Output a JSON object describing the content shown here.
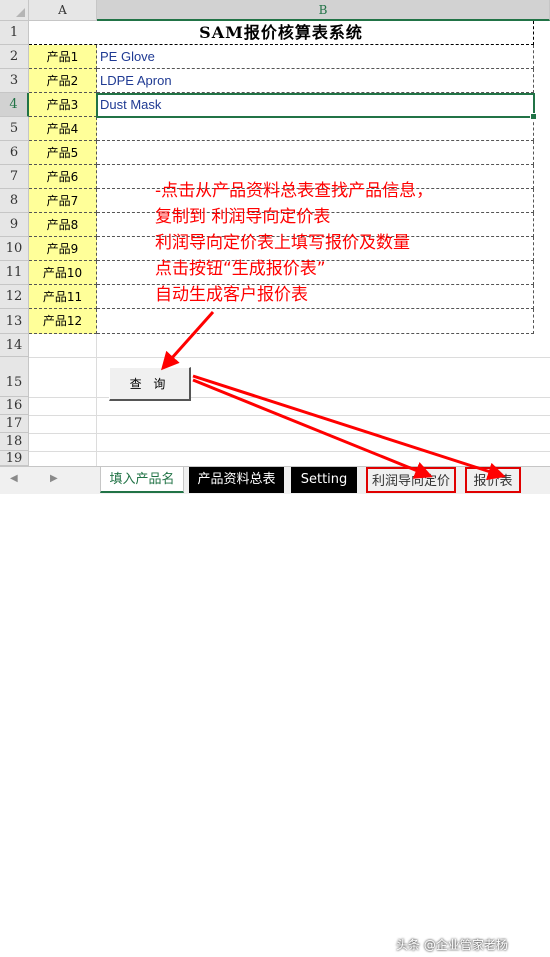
{
  "spreadsheet": {
    "columns": [
      "A",
      "B"
    ],
    "rows": [
      "1",
      "2",
      "3",
      "4",
      "5",
      "6",
      "7",
      "8",
      "9",
      "10",
      "11",
      "12",
      "13",
      "14",
      "15",
      "16",
      "17",
      "18",
      "19"
    ],
    "active_row": "4",
    "active_column": "B",
    "title": "SAM报价核算表系统",
    "products": [
      {
        "label": "产品1",
        "name": "PE Glove"
      },
      {
        "label": "产品2",
        "name": "LDPE Apron"
      },
      {
        "label": "产品3",
        "name": "Dust Mask"
      },
      {
        "label": "产品4",
        "name": ""
      },
      {
        "label": "产品5",
        "name": ""
      },
      {
        "label": "产品6",
        "name": ""
      },
      {
        "label": "产品7",
        "name": ""
      },
      {
        "label": "产品8",
        "name": ""
      },
      {
        "label": "产品9",
        "name": ""
      },
      {
        "label": "产品10",
        "name": ""
      },
      {
        "label": "产品11",
        "name": ""
      },
      {
        "label": "产品12",
        "name": ""
      }
    ]
  },
  "annotation": {
    "lines": [
      "-点击从产品资料总表查找产品信息，",
      "复制到 利润导向定价表",
      "利润导向定价表上填写报价及数量",
      "点击按钮“生成报价表”",
      "自动生成客户报价表"
    ],
    "color": "#ff0000"
  },
  "query_button": {
    "label": "查 询"
  },
  "sheet_tabs": {
    "items": [
      {
        "label": "填入产品名"
      },
      {
        "label": "产品资料总表"
      },
      {
        "label": "Setting"
      },
      {
        "label": "利润导向定价"
      },
      {
        "label": "报价表"
      }
    ],
    "nav_prev": "◀",
    "nav_next": "▶"
  },
  "watermark": "头条 @企业管家老杨",
  "colors": {
    "accent": "#217346",
    "highlight": "#ffff99",
    "annotation": "#ff0000",
    "input_text": "#1f3a93"
  }
}
